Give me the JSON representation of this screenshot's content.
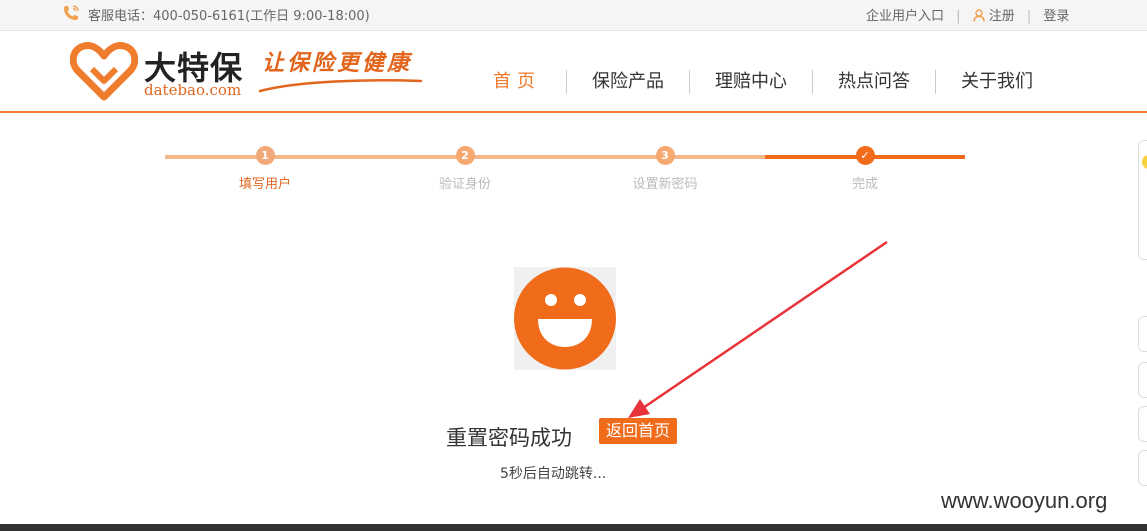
{
  "topbar": {
    "hotline": "客服电话：400-050-6161(工作日 9:00-18:00)",
    "enterprise_link": "企业用户入口",
    "register_link": "注册",
    "login_link": "登录"
  },
  "brand": {
    "name_cn": "大特保",
    "domain": "datebao.com",
    "slogan": "让保险更健康",
    "accent_color": "#f06b1a"
  },
  "nav": {
    "items": [
      {
        "label": "首页"
      },
      {
        "label": "保险产品"
      },
      {
        "label": "理赔中心"
      },
      {
        "label": "热点问答"
      },
      {
        "label": "关于我们"
      }
    ]
  },
  "steps": {
    "items": [
      {
        "number": "1",
        "label": "填写用户"
      },
      {
        "number": "2",
        "label": "验证身份"
      },
      {
        "number": "3",
        "label": "设置新密码"
      },
      {
        "number": "✓",
        "label": "完成"
      }
    ]
  },
  "result": {
    "message": "重置密码成功",
    "home_button": "返回首页",
    "redirect_text": "5秒后自动跳转..."
  },
  "watermark": "www.wooyun.org"
}
